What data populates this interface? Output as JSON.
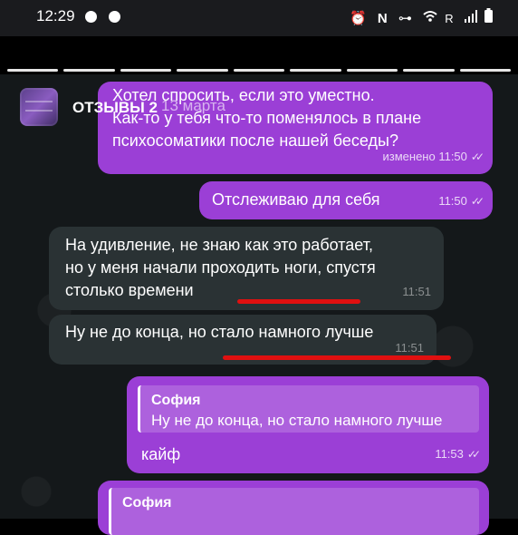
{
  "status_bar": {
    "time": "12:29",
    "icons": [
      "alarm-icon",
      "nfc-icon",
      "key-icon",
      "wifi-icon",
      "roaming-icon",
      "signal-icon",
      "battery-icon"
    ],
    "roaming_label": "R"
  },
  "story": {
    "title": "ОТЗЫВЫ 2",
    "date": "13 марта"
  },
  "messages": [
    {
      "direction": "outgoing",
      "lines": [
        "Хотел спросить, если это уместно.",
        "Как-то у тебя что-то поменялось в плане",
        "психосоматики после  нашей беседы?"
      ],
      "meta": "изменено 11:50",
      "read": true
    },
    {
      "direction": "outgoing",
      "lines": [
        "Отслеживаю для себя"
      ],
      "meta": "11:50",
      "read": true
    },
    {
      "direction": "incoming",
      "lines": [
        "На удивление, не знаю как это работает,",
        "но у меня начали проходить ноги, спустя",
        "столько времени"
      ],
      "meta": "11:51"
    },
    {
      "direction": "incoming",
      "lines": [
        "Ну не до конца, но стало намного лучше"
      ],
      "meta": "11:51"
    },
    {
      "direction": "outgoing",
      "reply": {
        "author": "София",
        "text": "Ну не до конца, но стало намного лучше"
      },
      "lines": [
        "кайф"
      ],
      "meta": "11:53",
      "read": true
    },
    {
      "direction": "outgoing",
      "reply": {
        "author": "София",
        "text": ""
      },
      "lines": []
    }
  ],
  "colors": {
    "outgoing_bubble": "#9b3fd6",
    "incoming_bubble": "#2a3234",
    "chat_background": "#14181a",
    "highlight_underline": "#e01010"
  }
}
